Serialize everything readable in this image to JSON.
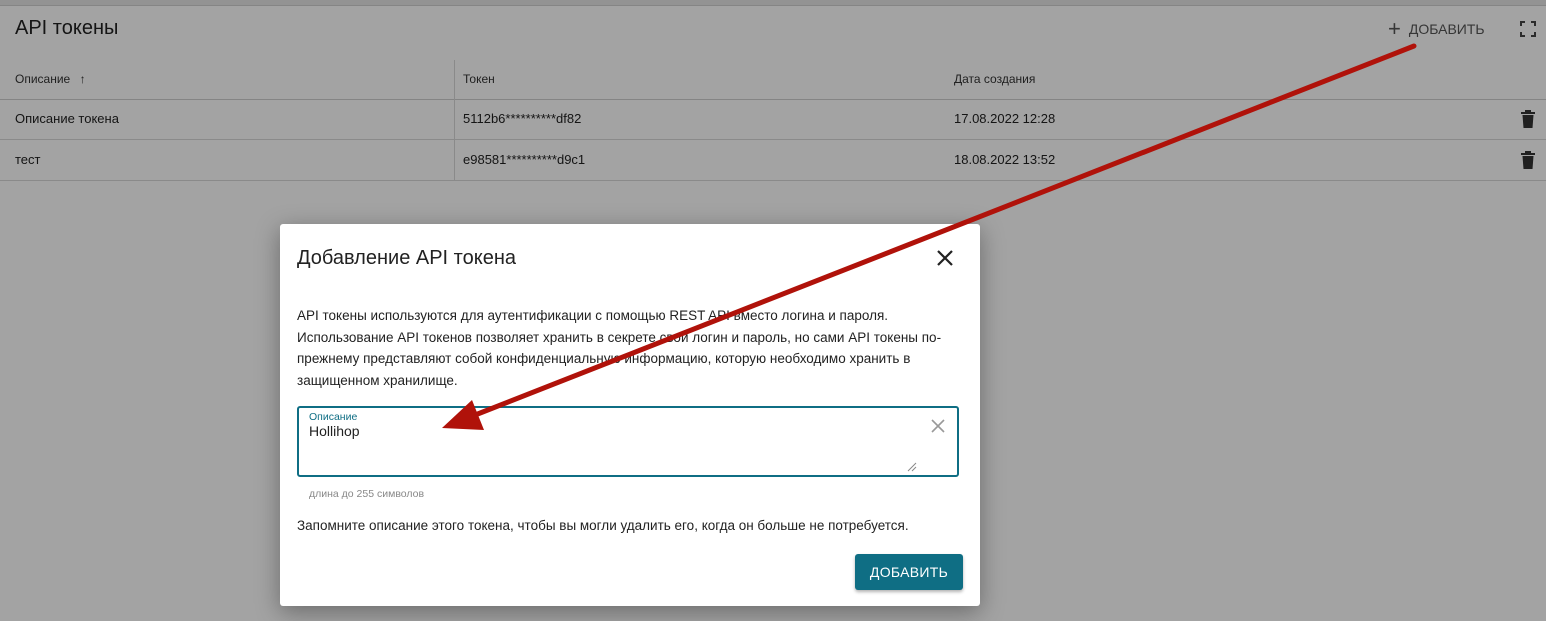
{
  "page": {
    "title": "API токены",
    "add_label": "ДОБАВИТЬ",
    "add_icon": "plus-icon",
    "fullscreen_icon": "fullscreen-icon"
  },
  "table": {
    "columns": [
      "Описание",
      "Токен",
      "Дата создания"
    ],
    "sort_indicator": "↑",
    "rows": [
      {
        "description": "Описание токена",
        "token": "5112b6**********df82",
        "created": "17.08.2022 12:28"
      },
      {
        "description": "тест",
        "token": "e98581**********d9c1",
        "created": "18.08.2022 13:52"
      }
    ]
  },
  "dialog": {
    "title": "Добавление API токена",
    "description": "API токены используются для аутентификации с помощью REST API вместо логина и пароля. Использование API токенов позволяет хранить в секрете свой логин и пароль, но сами API токены по-прежнему представляют собой конфиденциальную информацию, которую необходимо хранить в защищенном хранилище.",
    "field_label": "Описание",
    "field_value": "Hollihop",
    "field_hint": "длина до 255 символов",
    "note": "Запомните описание этого токена, чтобы вы могли удалить его, когда он больше не потребуется.",
    "submit_label": "ДОБАВИТЬ"
  },
  "colors": {
    "accent": "#0f6e84",
    "arrow": "#b0120a",
    "overlay": "rgba(0,0,0,0.36)"
  }
}
